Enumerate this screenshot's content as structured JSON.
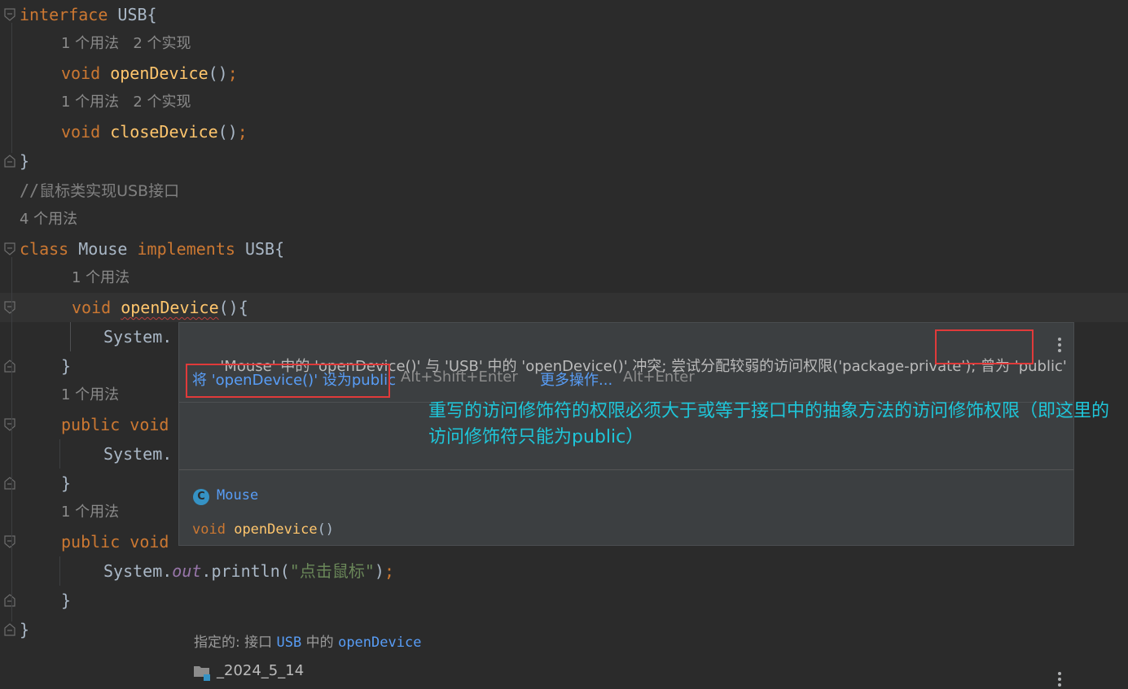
{
  "editor": {
    "lines": [
      {
        "id": "l1",
        "parts": [
          [
            "kw",
            "interface"
          ],
          [
            "pl",
            " USB{"
          ]
        ]
      },
      {
        "id": "h1",
        "hint": "1 个用法   2 个实现"
      },
      {
        "id": "l2",
        "parts": [
          [
            "kw",
            "void "
          ],
          [
            "fn",
            "openDevice"
          ],
          [
            "pl",
            "()"
          ],
          [
            "kw",
            ";"
          ]
        ]
      },
      {
        "id": "h2",
        "hint": "1 个用法   2 个实现"
      },
      {
        "id": "l3",
        "parts": [
          [
            "kw",
            "void "
          ],
          [
            "fn",
            "closeDevice"
          ],
          [
            "pl",
            "()"
          ],
          [
            "kw",
            ";"
          ]
        ]
      },
      {
        "id": "l4",
        "parts": [
          [
            "pl",
            "}"
          ]
        ]
      },
      {
        "id": "l5",
        "parts": [
          [
            "cm",
            "//"
          ],
          [
            "cmcn",
            "鼠标类实现USB接口"
          ]
        ]
      },
      {
        "id": "h3",
        "hint": "4 个用法"
      },
      {
        "id": "l6",
        "parts": [
          [
            "kw",
            "class"
          ],
          [
            "pl",
            " Mouse "
          ],
          [
            "kw",
            "implements"
          ],
          [
            "pl",
            " USB{"
          ]
        ]
      },
      {
        "id": "h4",
        "hint": "1 个用法"
      },
      {
        "id": "l7",
        "parts": [
          [
            "kw",
            "void "
          ],
          [
            "fnsq",
            "openDevice"
          ],
          [
            "pl",
            "(){"
          ]
        ]
      },
      {
        "id": "l8",
        "parts": [
          [
            "pl",
            "System."
          ]
        ]
      },
      {
        "id": "l9",
        "parts": [
          [
            "pl",
            "}"
          ]
        ]
      },
      {
        "id": "h5",
        "hint": "1 个用法"
      },
      {
        "id": "l10",
        "parts": [
          [
            "kw",
            "public void"
          ]
        ]
      },
      {
        "id": "l11",
        "parts": [
          [
            "pl",
            "System."
          ]
        ]
      },
      {
        "id": "l12",
        "parts": [
          [
            "pl",
            "}"
          ]
        ]
      },
      {
        "id": "h6",
        "hint": "1 个用法"
      },
      {
        "id": "l13",
        "parts": [
          [
            "kw",
            "public void"
          ]
        ]
      },
      {
        "id": "l14",
        "parts": [
          [
            "pl",
            "System."
          ],
          [
            "field",
            "out"
          ],
          [
            "pl",
            ".println("
          ],
          [
            "str",
            "\"点击鼠标\""
          ],
          [
            "pl",
            ")"
          ],
          [
            "kw",
            ";"
          ]
        ]
      },
      {
        "id": "l15",
        "parts": [
          [
            "pl",
            "}"
          ]
        ]
      },
      {
        "id": "l16",
        "parts": [
          [
            "pl",
            "}"
          ]
        ]
      }
    ]
  },
  "popup": {
    "message": "'Mouse' 中的 'openDevice()' 与 'USB' 中的 'openDevice()' 冲突; 尝试分配较弱的访问权限('package-private'); ",
    "message_highlight": "曾为 'public'",
    "fix_action": "将 'openDevice()' 设为public",
    "fix_shortcut": "Alt+Shift+Enter",
    "more_actions": "更多操作...",
    "more_shortcut": "Alt+Enter",
    "class_icon": "C",
    "class_name": "Mouse",
    "signature_kw": "void",
    "signature_name": "openDevice",
    "signature_parens": "()",
    "specified_label": "指定的: 接口 ",
    "specified_iface": "USB",
    "specified_mid": " 中的 ",
    "specified_method": "openDevice",
    "module_name": "_2024_5_14"
  },
  "annotation": "重写的访问修饰符的权限必须大于或等于接口中的抽象方法的访问修饰权限（即这里的访问修饰符只能为public）",
  "colors": {
    "background": "#2b2b2b",
    "keyword": "#cc7832",
    "function": "#ffc66d",
    "string": "#6a8759",
    "link": "#589df6",
    "annotation": "#1fc6d9",
    "highlight_box": "#e03a3a"
  }
}
